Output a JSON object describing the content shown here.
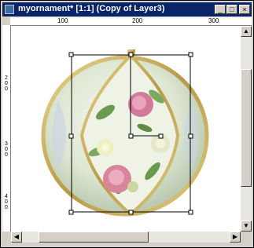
{
  "window": {
    "title": "myornament* [1:1] (Copy of Layer3)",
    "minimize_glyph": "_",
    "maximize_glyph": "□",
    "close_glyph": "×"
  },
  "ruler": {
    "top_labels": [
      "100",
      "200",
      "300"
    ],
    "left_labels": [
      "200",
      "300",
      "400"
    ]
  },
  "scroll": {
    "up": "▲",
    "down": "▼",
    "left": "◀",
    "right": "▶"
  },
  "icons": {
    "app": "document-icon"
  },
  "colors": {
    "titlebar": "#0a246a",
    "ornament_rim": "#c8b060",
    "rose_pink": "#d37a9a",
    "leaf_green": "#6a9a50",
    "selection_box": "#000000"
  }
}
